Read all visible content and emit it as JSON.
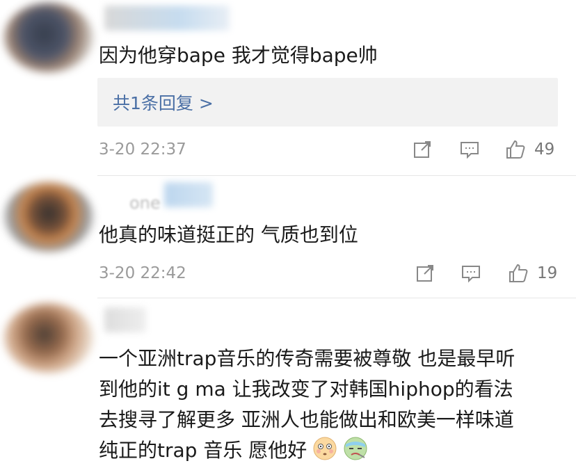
{
  "comments": [
    {
      "text": "因为他穿bape 我才觉得bape帅",
      "reply_link": "共1条回复 >",
      "time": "3-20 22:37",
      "likes": "49"
    },
    {
      "username_fragment": "one",
      "text": "他真的味道挺正的 气质也到位",
      "time": "3-20 22:42",
      "likes": "19"
    },
    {
      "text_lines": [
        "一个亚洲trap音乐的传奇需要被尊敬 也是最早听",
        "到他的it g ma 让我改变了对韩国hiphop的看法",
        "去搜寻了解更多 亚洲人也能做出和欧美一样味道",
        "纯正的trap 音乐 愿他好"
      ]
    }
  ],
  "icons": {
    "share": "share-icon",
    "comment": "comment-icon",
    "like": "thumbs-up-icon",
    "emoji1": "flushed-face-emoji",
    "emoji2": "sick-face-emoji"
  },
  "colors": {
    "text": "#1a1a1a",
    "meta": "#9a9a9a",
    "link": "#4a6fa5",
    "reply_bg": "#f2f2f2"
  }
}
